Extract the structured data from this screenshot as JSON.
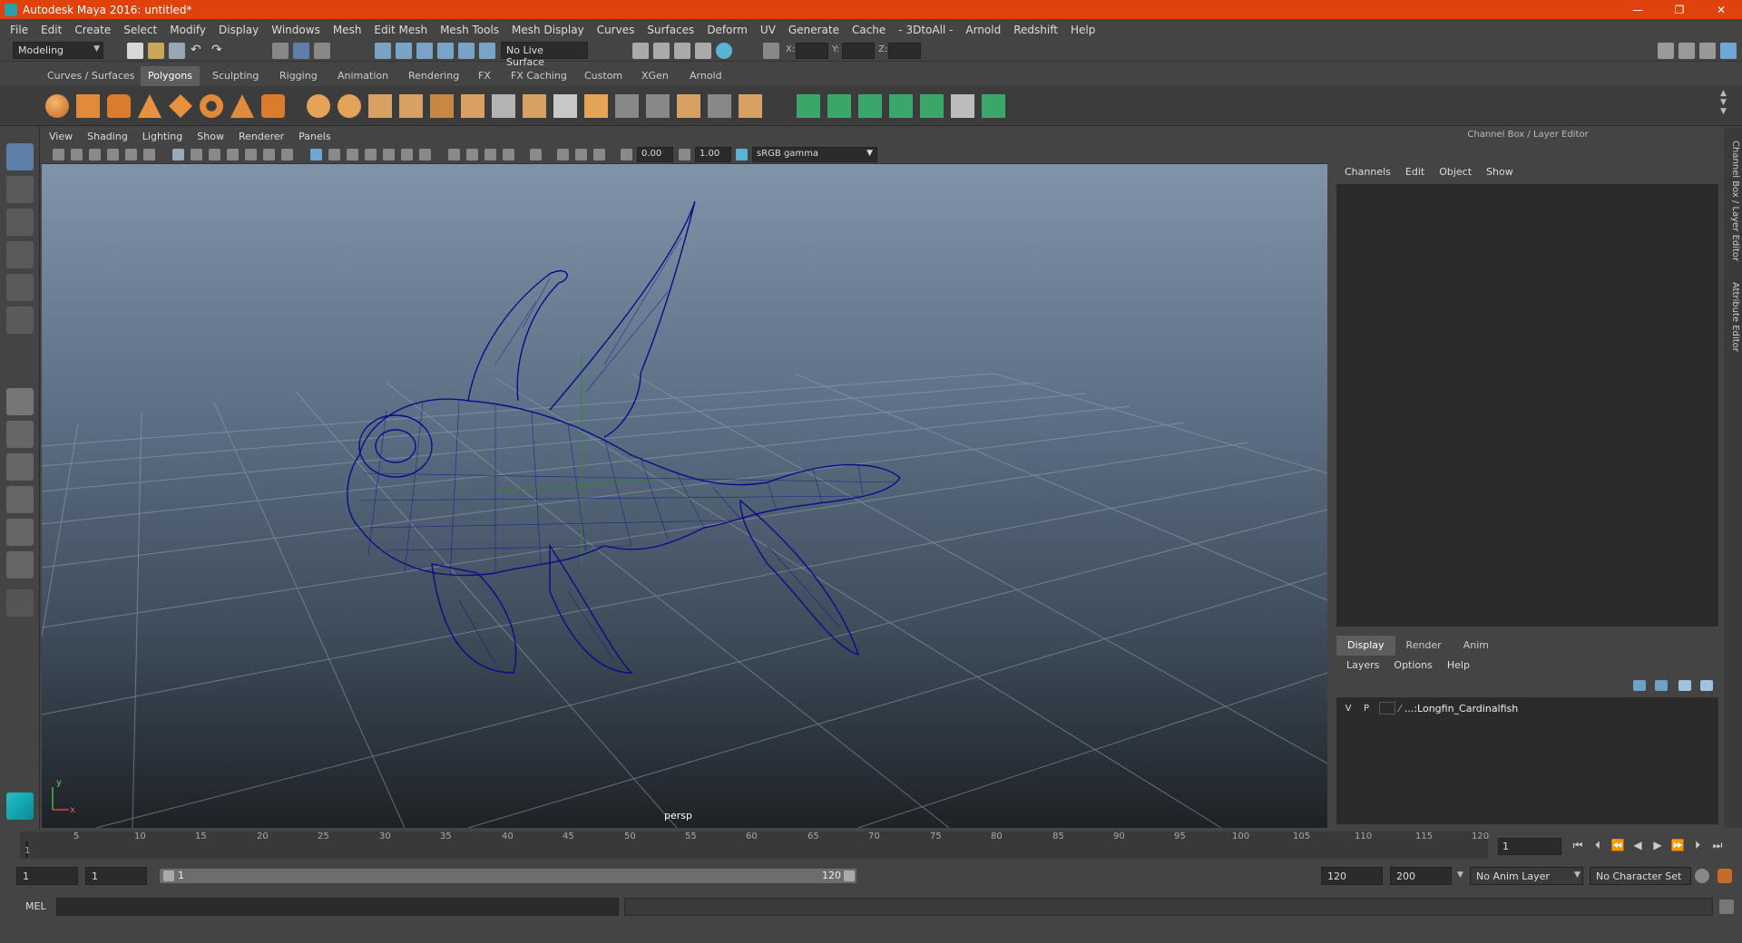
{
  "window": {
    "title": "Autodesk Maya 2016: untitled*",
    "minimize": "—",
    "maximize": "❐",
    "close": "✕"
  },
  "menubar": [
    "File",
    "Edit",
    "Create",
    "Select",
    "Modify",
    "Display",
    "Windows",
    "Mesh",
    "Edit Mesh",
    "Mesh Tools",
    "Mesh Display",
    "Curves",
    "Surfaces",
    "Deform",
    "UV",
    "Generate",
    "Cache",
    "- 3DtoAll -",
    "Arnold",
    "Redshift",
    "Help"
  ],
  "statusline": {
    "mode": "Modeling",
    "live_surface": "No Live Surface",
    "x_label": "X:",
    "y_label": "Y:",
    "z_label": "Z:"
  },
  "shelf": {
    "tabs": [
      "Curves / Surfaces",
      "Polygons",
      "Sculpting",
      "Rigging",
      "Animation",
      "Rendering",
      "FX",
      "FX Caching",
      "Custom",
      "XGen",
      "Arnold"
    ],
    "active_tab": "Polygons"
  },
  "viewport": {
    "menus": [
      "View",
      "Shading",
      "Lighting",
      "Show",
      "Renderer",
      "Panels"
    ],
    "exposure": "0.00",
    "gamma": "1.00",
    "color_space": "sRGB gamma",
    "camera_label": "persp",
    "axis_y": "y",
    "axis_x": "x",
    "grid_color": "#9aa6b2",
    "wireframe_color": "#0a0a8a"
  },
  "channel_box": {
    "title": "Channel Box / Layer Editor",
    "menus": [
      "Channels",
      "Edit",
      "Object",
      "Show"
    ]
  },
  "layer_editor": {
    "tabs": [
      "Display",
      "Render",
      "Anim"
    ],
    "active_tab": "Display",
    "menus": [
      "Layers",
      "Options",
      "Help"
    ],
    "layers": [
      {
        "visible": "V",
        "playback": "P",
        "name": "...:Longfin_Cardinalfish"
      }
    ]
  },
  "side_tabs": [
    "Channel Box / Layer Editor",
    "Attribute Editor"
  ],
  "timeline": {
    "ticks": [
      "1",
      "5",
      "10",
      "15",
      "20",
      "25",
      "30",
      "35",
      "40",
      "45",
      "50",
      "55",
      "60",
      "65",
      "70",
      "75",
      "80",
      "85",
      "90",
      "95",
      "100",
      "105",
      "110",
      "115",
      "120"
    ],
    "current_frame": "1"
  },
  "range": {
    "start_field": "1",
    "inner_start_field": "1",
    "slider_start": "1",
    "slider_end": "120",
    "end_field": "120",
    "anim_end": "200",
    "anim_layer": "No Anim Layer",
    "character_set": "No Character Set"
  },
  "command_line": {
    "label": "MEL"
  }
}
